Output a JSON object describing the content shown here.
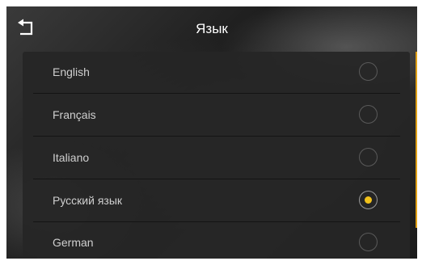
{
  "header": {
    "title": "Язык",
    "back_icon": "back-arrow-icon"
  },
  "languages": [
    {
      "label": "English",
      "selected": false
    },
    {
      "label": "Français",
      "selected": false
    },
    {
      "label": "Italiano",
      "selected": false
    },
    {
      "label": "Русский язык",
      "selected": true
    },
    {
      "label": "German",
      "selected": false
    }
  ],
  "colors": {
    "accent": "#f2c21b",
    "scroll_indicator": "#e0a016"
  }
}
